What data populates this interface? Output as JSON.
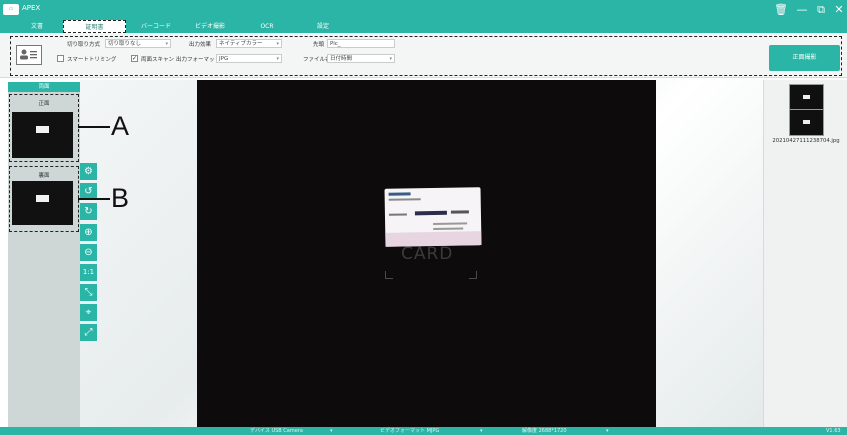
{
  "app": {
    "title": "APEX",
    "version": "V1.63"
  },
  "tabs": [
    "文書",
    "証明書",
    "バーコード",
    "ビデオ撮影",
    "OCR",
    "設定"
  ],
  "toolbar": {
    "crop_mode_label": "切り取り方式",
    "crop_mode_value": "切り取りなし",
    "output_effect_label": "出力効果",
    "output_effect_value": "ネイティブカラー",
    "prefix_label": "先頭",
    "prefix_value": "Pic_",
    "smart_trimming_label": "スマートトリミング",
    "smart_trimming_checked": false,
    "duplex_scan_label": "両面スキャン",
    "duplex_scan_checked": true,
    "output_format_label": "出力フォーマット",
    "output_format_value": "JPG",
    "filename_label": "ファイル名",
    "filename_value": "日付時間",
    "capture_button": "正面撮影"
  },
  "side_panel": {
    "header": "両面",
    "front_label": "正面",
    "back_label": "裏面"
  },
  "annotations": {
    "a": "A",
    "b": "B"
  },
  "preview": {
    "card_text": "CARD"
  },
  "right_panel": {
    "filename": "20210427111238704.jpg"
  },
  "status": {
    "device": "デバイス USB Camera",
    "video_format": "ビデオフォーマット MJPG",
    "resolution": "解像度 2688*1720"
  },
  "colors": {
    "accent": "#2bb5a6",
    "preview_bg": "#0d0b0c"
  }
}
